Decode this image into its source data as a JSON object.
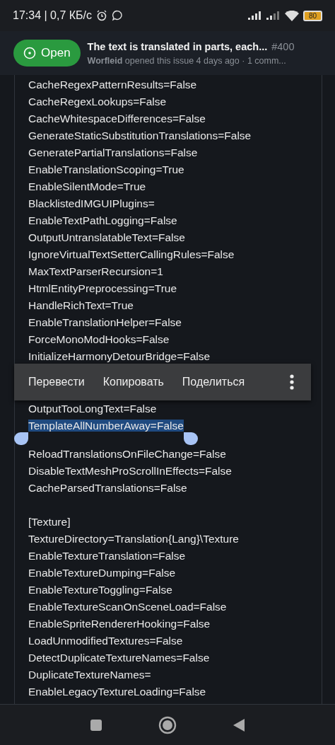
{
  "status_bar": {
    "time": "17:34 | 0,7 КБ/с",
    "battery": "80"
  },
  "issue": {
    "state": "Open",
    "open": true,
    "title": "The text is translated in parts, each...",
    "number": "#400",
    "meta": "**Worfleid** opened this issue 4 days ago · 1 comm..."
  },
  "blocks": [
    {
      "lines": [
        {
          "text": "CacheRegexPatternResults=False",
          "selected": false
        },
        {
          "text": "CacheRegexLookups=False",
          "selected": false
        },
        {
          "text": "CacheWhitespaceDifferences=False",
          "selected": false
        },
        {
          "text": "GenerateStaticSubstitutionTranslations=False",
          "selected": false
        },
        {
          "text": "GeneratePartialTranslations=False",
          "selected": false
        },
        {
          "text": "EnableTranslationScoping=True",
          "selected": false
        },
        {
          "text": "EnableSilentMode=True",
          "selected": false
        },
        {
          "text": "BlacklistedIMGUIPlugins=",
          "selected": false
        },
        {
          "text": "EnableTextPathLogging=False",
          "selected": false
        },
        {
          "text": "OutputUntranslatableText=False",
          "selected": false
        },
        {
          "text": "IgnoreVirtualTextSetterCallingRules=False",
          "selected": false
        },
        {
          "text": "MaxTextParserRecursion=1",
          "selected": false
        },
        {
          "text": "HtmlEntityPreprocessing=True",
          "selected": false
        },
        {
          "text": "HandleRichText=True",
          "selected": false
        },
        {
          "text": "EnableTranslationHelper=False",
          "selected": false
        },
        {
          "text": "ForceMonoModHooks=False",
          "selected": false
        },
        {
          "text": "InitializeHarmonyDetourBridge=False",
          "selected": false
        }
      ],
      "menu": [
        "Перевести",
        "Копировать",
        "Поделиться"
      ]
    },
    {
      "lines": [
        {
          "text": "OutputTooLongText=False",
          "selected": false
        },
        {
          "text": "TemplateAllNumberAway=False",
          "selected": true
        },
        {
          "text": "ReloadTranslationsOnFileChange=False",
          "selected": false
        },
        {
          "text": "DisableTextMeshProScrollInEffects=False",
          "selected": false
        },
        {
          "text": "CacheParsedTranslations=False",
          "selected": false
        }
      ]
    },
    {
      "lines": [
        {
          "text": "[Texture]",
          "selected": false
        },
        {
          "text": "TextureDirectory=Translation{Lang}\\Texture",
          "selected": false
        },
        {
          "text": "EnableTextureTranslation=False",
          "selected": false
        },
        {
          "text": "EnableTextureDumping=False",
          "selected": false
        },
        {
          "text": "EnableTextureToggling=False",
          "selected": false
        },
        {
          "text": "EnableTextureScanOnSceneLoad=False",
          "selected": false
        },
        {
          "text": "EnableSpriteRendererHooking=False",
          "selected": false
        },
        {
          "text": "LoadUnmodifiedTextures=False",
          "selected": false
        },
        {
          "text": "DetectDuplicateTextureNames=False",
          "selected": false
        },
        {
          "text": "DuplicateTextureNames=",
          "selected": false
        },
        {
          "text": "EnableLegacyTextureLoading=False",
          "selected": false
        }
      ]
    }
  ]
}
